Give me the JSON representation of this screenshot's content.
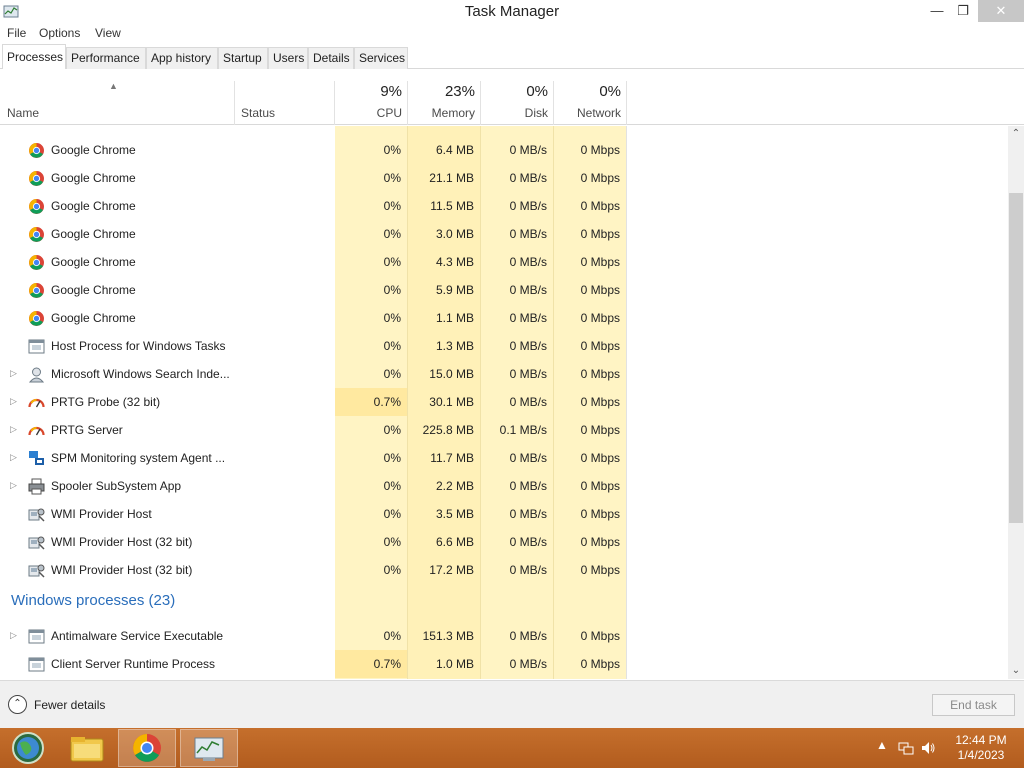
{
  "window": {
    "title": "Task Manager"
  },
  "menu": [
    "File",
    "Options",
    "View"
  ],
  "tabs": [
    "Processes",
    "Performance",
    "App history",
    "Startup",
    "Users",
    "Details",
    "Services"
  ],
  "columns": {
    "name": "Name",
    "status": "Status",
    "cpu": {
      "pct": "9%",
      "label": "CPU"
    },
    "memory": {
      "pct": "23%",
      "label": "Memory"
    },
    "disk": {
      "pct": "0%",
      "label": "Disk"
    },
    "network": {
      "pct": "0%",
      "label": "Network"
    }
  },
  "processes": [
    {
      "name": "Google Chrome",
      "icon": "chrome-icon",
      "cpu": "0%",
      "memory": "6.4 MB",
      "disk": "0 MB/s",
      "network": "0 Mbps",
      "expandable": false
    },
    {
      "name": "Google Chrome",
      "icon": "chrome-icon",
      "cpu": "0%",
      "memory": "21.1 MB",
      "disk": "0 MB/s",
      "network": "0 Mbps",
      "expandable": false
    },
    {
      "name": "Google Chrome",
      "icon": "chrome-icon",
      "cpu": "0%",
      "memory": "11.5 MB",
      "disk": "0 MB/s",
      "network": "0 Mbps",
      "expandable": false
    },
    {
      "name": "Google Chrome",
      "icon": "chrome-icon",
      "cpu": "0%",
      "memory": "3.0 MB",
      "disk": "0 MB/s",
      "network": "0 Mbps",
      "expandable": false
    },
    {
      "name": "Google Chrome",
      "icon": "chrome-icon",
      "cpu": "0%",
      "memory": "4.3 MB",
      "disk": "0 MB/s",
      "network": "0 Mbps",
      "expandable": false
    },
    {
      "name": "Google Chrome",
      "icon": "chrome-icon",
      "cpu": "0%",
      "memory": "5.9 MB",
      "disk": "0 MB/s",
      "network": "0 Mbps",
      "expandable": false
    },
    {
      "name": "Google Chrome",
      "icon": "chrome-icon",
      "cpu": "0%",
      "memory": "1.1 MB",
      "disk": "0 MB/s",
      "network": "0 Mbps",
      "expandable": false
    },
    {
      "name": "Host Process for Windows Tasks",
      "icon": "window-app-icon",
      "cpu": "0%",
      "memory": "1.3 MB",
      "disk": "0 MB/s",
      "network": "0 Mbps",
      "expandable": false
    },
    {
      "name": "Microsoft Windows Search Inde...",
      "icon": "search-indexer-icon",
      "cpu": "0%",
      "memory": "15.0 MB",
      "disk": "0 MB/s",
      "network": "0 Mbps",
      "expandable": true
    },
    {
      "name": "PRTG Probe (32 bit)",
      "icon": "gauge-icon",
      "cpu": "0.7%",
      "memory": "30.1 MB",
      "disk": "0 MB/s",
      "network": "0 Mbps",
      "expandable": true
    },
    {
      "name": "PRTG Server",
      "icon": "gauge-icon",
      "cpu": "0%",
      "memory": "225.8 MB",
      "disk": "0.1 MB/s",
      "network": "0 Mbps",
      "expandable": true
    },
    {
      "name": "SPM Monitoring system Agent ...",
      "icon": "monitor-agent-icon",
      "cpu": "0%",
      "memory": "11.7 MB",
      "disk": "0 MB/s",
      "network": "0 Mbps",
      "expandable": true
    },
    {
      "name": "Spooler SubSystem App",
      "icon": "printer-icon",
      "cpu": "0%",
      "memory": "2.2 MB",
      "disk": "0 MB/s",
      "network": "0 Mbps",
      "expandable": true
    },
    {
      "name": "WMI Provider Host",
      "icon": "wmi-icon",
      "cpu": "0%",
      "memory": "3.5 MB",
      "disk": "0 MB/s",
      "network": "0 Mbps",
      "expandable": false
    },
    {
      "name": "WMI Provider Host (32 bit)",
      "icon": "wmi-icon",
      "cpu": "0%",
      "memory": "6.6 MB",
      "disk": "0 MB/s",
      "network": "0 Mbps",
      "expandable": false
    },
    {
      "name": "WMI Provider Host (32 bit)",
      "icon": "wmi-icon",
      "cpu": "0%",
      "memory": "17.2 MB",
      "disk": "0 MB/s",
      "network": "0 Mbps",
      "expandable": false
    }
  ],
  "windows_group": {
    "title": "Windows processes (23)",
    "processes": [
      {
        "name": "Antimalware Service Executable",
        "icon": "window-app-icon",
        "cpu": "0%",
        "memory": "151.3 MB",
        "disk": "0 MB/s",
        "network": "0 Mbps",
        "expandable": true
      },
      {
        "name": "Client Server Runtime Process",
        "icon": "window-app-icon",
        "cpu": "0.7%",
        "memory": "1.0 MB",
        "disk": "0 MB/s",
        "network": "0 Mbps",
        "expandable": false
      }
    ]
  },
  "footer": {
    "fewer_details": "Fewer details",
    "end_task": "End task"
  },
  "taskbar": {
    "apps": [
      "start-globe-icon",
      "file-explorer-icon",
      "chrome-icon",
      "task-manager-icon"
    ],
    "time": "12:44 PM",
    "date": "1/4/2023"
  },
  "colors": {
    "accent_blue": "#2a6ebb",
    "taskbar_orange": "#b8621f",
    "heat_light": "#fff4c4",
    "heat_mid": "#ffe9a0"
  }
}
